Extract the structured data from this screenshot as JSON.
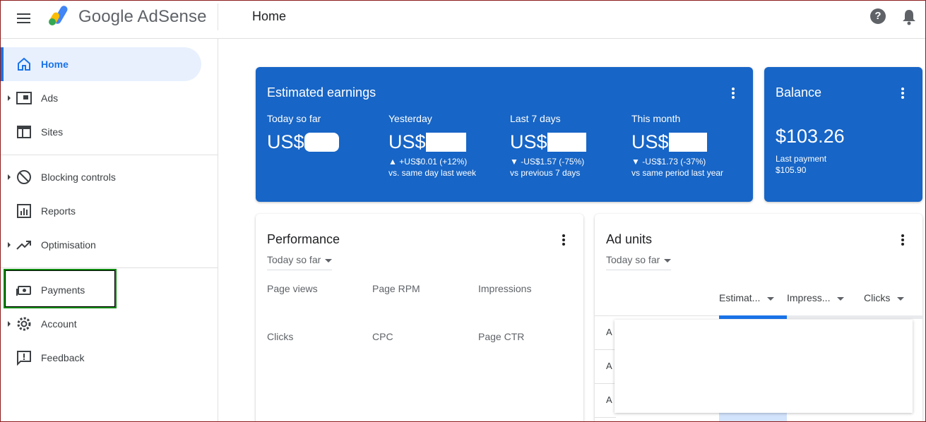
{
  "header": {
    "brand": "Google AdSense",
    "page_title": "Home",
    "help_glyph": "?"
  },
  "sidebar": {
    "items": [
      {
        "label": "Home",
        "icon": "home-icon"
      },
      {
        "label": "Ads",
        "icon": "ads-icon"
      },
      {
        "label": "Sites",
        "icon": "sites-icon"
      },
      {
        "label": "Blocking controls",
        "icon": "block-icon"
      },
      {
        "label": "Reports",
        "icon": "reports-icon"
      },
      {
        "label": "Optimisation",
        "icon": "trending-icon"
      },
      {
        "label": "Payments",
        "icon": "payments-icon"
      },
      {
        "label": "Account",
        "icon": "gear-icon"
      },
      {
        "label": "Feedback",
        "icon": "feedback-icon"
      }
    ]
  },
  "earnings": {
    "title": "Estimated earnings",
    "metrics": [
      {
        "label": "Today so far",
        "value_prefix": "US$",
        "change": "",
        "compare": ""
      },
      {
        "label": "Yesterday",
        "value_prefix": "US$",
        "change": "▲ +US$0.01 (+12%)",
        "compare": "vs. same day last week"
      },
      {
        "label": "Last 7 days",
        "value_prefix": "US$",
        "change": "▼ -US$1.57 (-75%)",
        "compare": "vs previous 7 days"
      },
      {
        "label": "This month",
        "value_prefix": "US$",
        "change": "▼ -US$1.73 (-37%)",
        "compare": "vs same period last year"
      }
    ]
  },
  "balance": {
    "title": "Balance",
    "amount": "$103.26",
    "last_payment_label": "Last payment",
    "last_payment_amount": "$105.90"
  },
  "performance": {
    "title": "Performance",
    "range": "Today so far",
    "metrics": [
      "Page views",
      "Page RPM",
      "Impressions",
      "Clicks",
      "CPC",
      "Page CTR"
    ]
  },
  "ad_units": {
    "title": "Ad units",
    "range": "Today so far",
    "columns": [
      "Estimat...",
      "Impress...",
      "Clicks"
    ],
    "rows": [
      "A",
      "A",
      "A"
    ]
  },
  "colors": {
    "accent": "#1a73e8",
    "card_blue": "#1765c6",
    "highlight": "#0f8a0f"
  }
}
